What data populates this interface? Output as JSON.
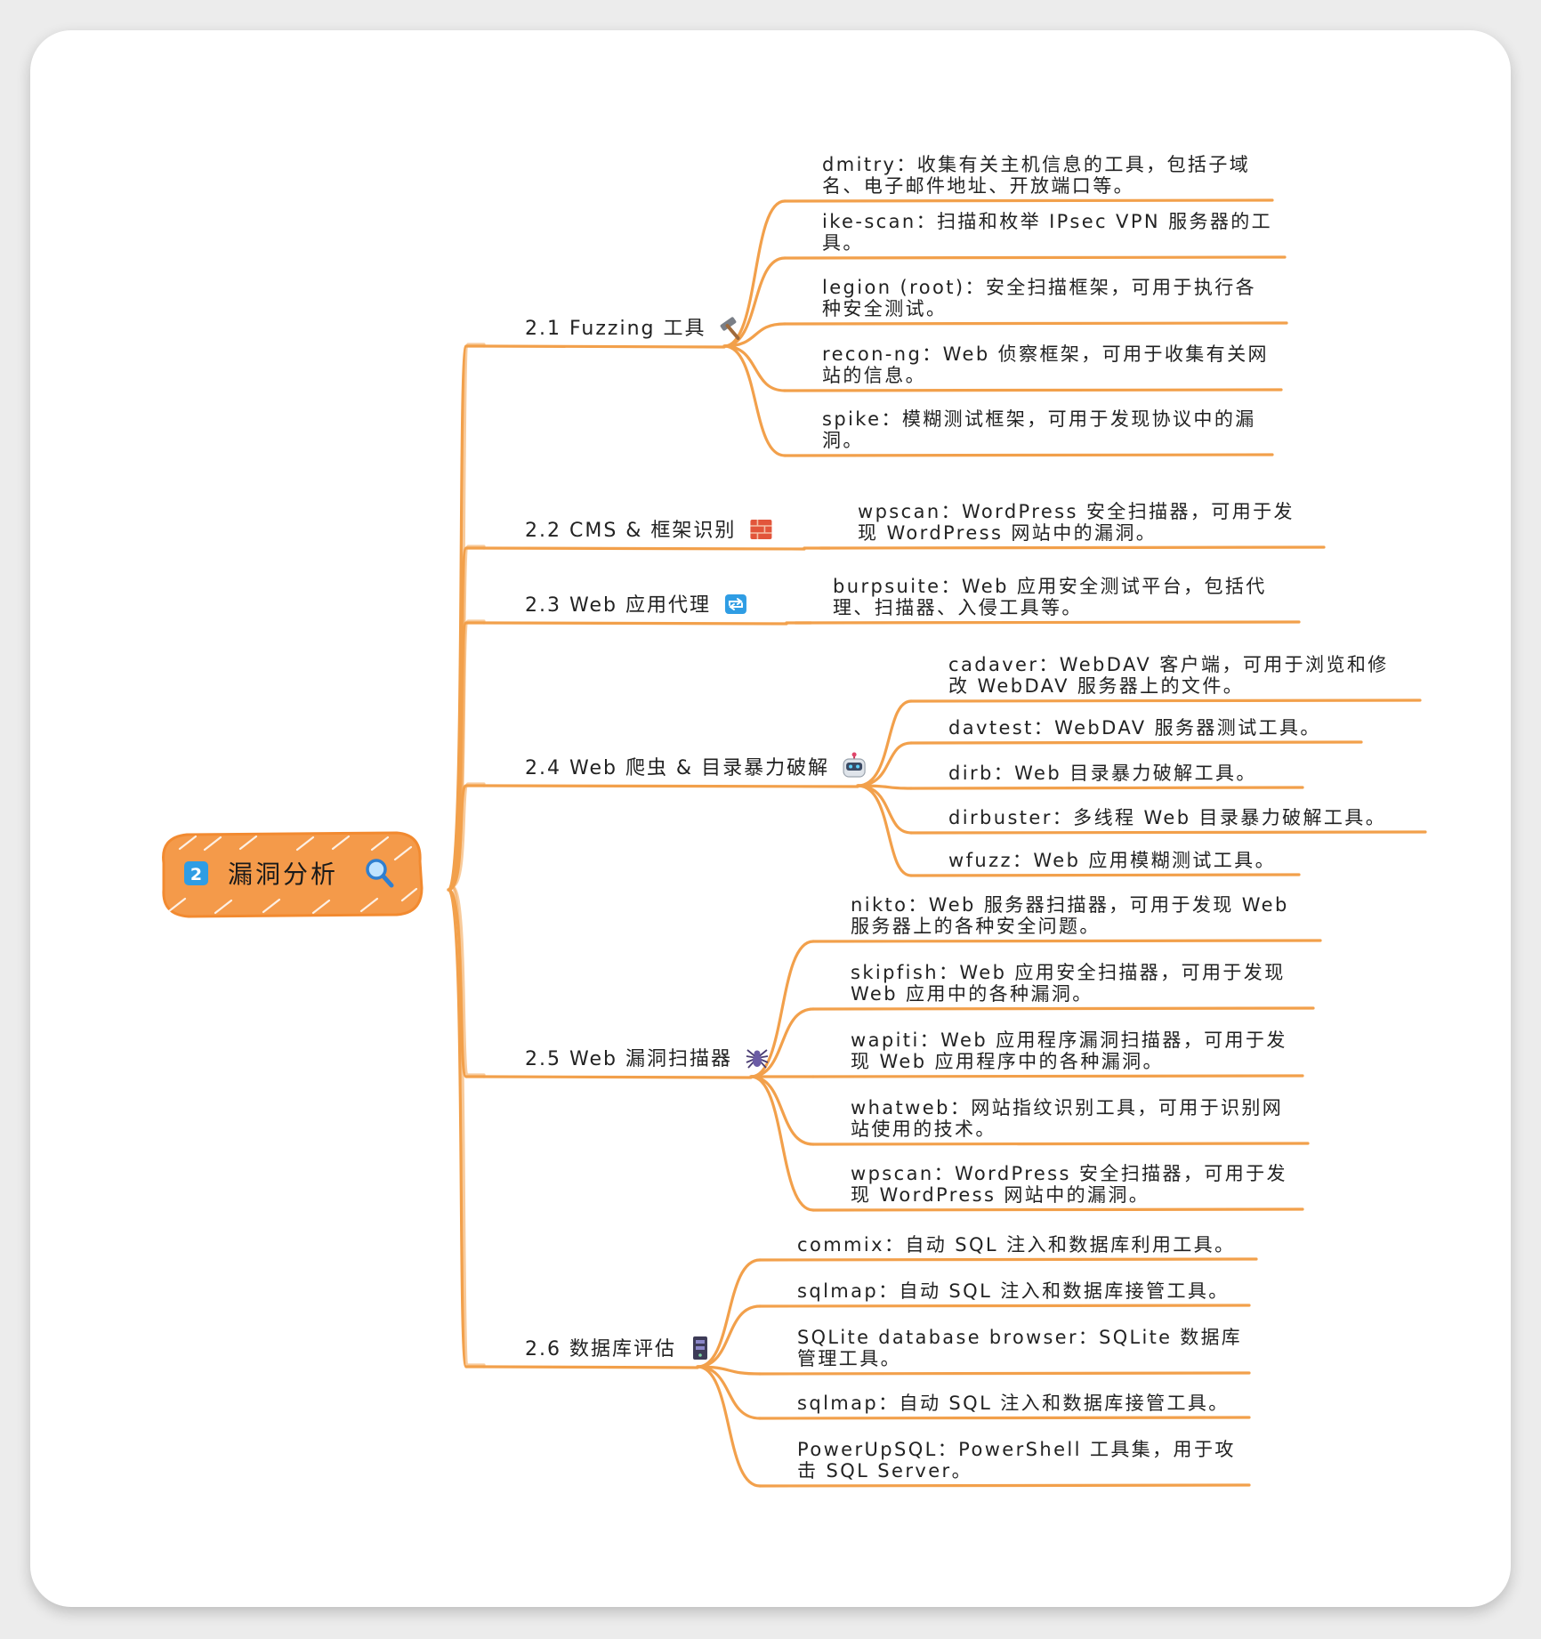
{
  "mindmap": {
    "root": {
      "badge": "2",
      "label": "漏洞分析",
      "icon": "magnifier-icon"
    },
    "colors": {
      "branch": "#f2a04b",
      "root_fill": "#f49a4a",
      "card": "#ffffff",
      "background": "#ececec"
    },
    "topics": [
      {
        "label": "2.1 Fuzzing 工具",
        "icon": "hammer-icon",
        "leaves": [
          {
            "lines": [
              "dmitry：收集有关主机信息的工具，包括子域",
              "名、电子邮件地址、开放端口等。"
            ]
          },
          {
            "lines": [
              "ike-scan：扫描和枚举 IPsec VPN 服务器的工",
              "具。"
            ]
          },
          {
            "lines": [
              "legion (root)：安全扫描框架，可用于执行各",
              "种安全测试。"
            ]
          },
          {
            "lines": [
              "recon-ng：Web 侦察框架，可用于收集有关网",
              "站的信息。"
            ]
          },
          {
            "lines": [
              "spike：模糊测试框架，可用于发现协议中的漏",
              "洞。"
            ]
          }
        ]
      },
      {
        "label": "2.2 CMS & 框架识别",
        "icon": "brick-icon",
        "leaves": [
          {
            "lines": [
              "wpscan：WordPress 安全扫描器，可用于发",
              "现 WordPress 网站中的漏洞。"
            ]
          }
        ]
      },
      {
        "label": "2.3 Web 应用代理",
        "icon": "repeat-icon",
        "leaves": [
          {
            "lines": [
              "burpsuite：Web 应用安全测试平台，包括代",
              "理、扫描器、入侵工具等。"
            ]
          }
        ]
      },
      {
        "label": "2.4 Web 爬虫 & 目录暴力破解",
        "icon": "robot-icon",
        "leaves": [
          {
            "lines": [
              "cadaver：WebDAV 客户端，可用于浏览和修",
              "改 WebDAV 服务器上的文件。"
            ]
          },
          {
            "lines": [
              "davtest：WebDAV 服务器测试工具。"
            ]
          },
          {
            "lines": [
              "dirb：Web 目录暴力破解工具。"
            ]
          },
          {
            "lines": [
              "dirbuster：多线程 Web 目录暴力破解工具。"
            ]
          },
          {
            "lines": [
              "wfuzz：Web 应用模糊测试工具。"
            ]
          }
        ]
      },
      {
        "label": "2.5 Web 漏洞扫描器",
        "icon": "spider-icon",
        "leaves": [
          {
            "lines": [
              "nikto：Web 服务器扫描器，可用于发现 Web",
              "服务器上的各种安全问题。"
            ]
          },
          {
            "lines": [
              "skipfish：Web 应用安全扫描器，可用于发现",
              "Web 应用中的各种漏洞。"
            ]
          },
          {
            "lines": [
              "wapiti：Web 应用程序漏洞扫描器，可用于发",
              "现 Web 应用程序中的各种漏洞。"
            ]
          },
          {
            "lines": [
              "whatweb：网站指纹识别工具，可用于识别网",
              "站使用的技术。"
            ]
          },
          {
            "lines": [
              "wpscan：WordPress 安全扫描器，可用于发",
              "现 WordPress 网站中的漏洞。"
            ]
          }
        ]
      },
      {
        "label": "2.6 数据库评估",
        "icon": "server-icon",
        "leaves": [
          {
            "lines": [
              "commix：自动 SQL 注入和数据库利用工具。"
            ]
          },
          {
            "lines": [
              "sqlmap：自动 SQL 注入和数据库接管工具。"
            ]
          },
          {
            "lines": [
              "SQLite database browser：SQLite 数据库",
              "管理工具。"
            ]
          },
          {
            "lines": [
              "sqlmap：自动 SQL 注入和数据库接管工具。"
            ]
          },
          {
            "lines": [
              "PowerUpSQL：PowerShell 工具集，用于攻",
              "击 SQL Server。"
            ]
          }
        ]
      }
    ]
  }
}
